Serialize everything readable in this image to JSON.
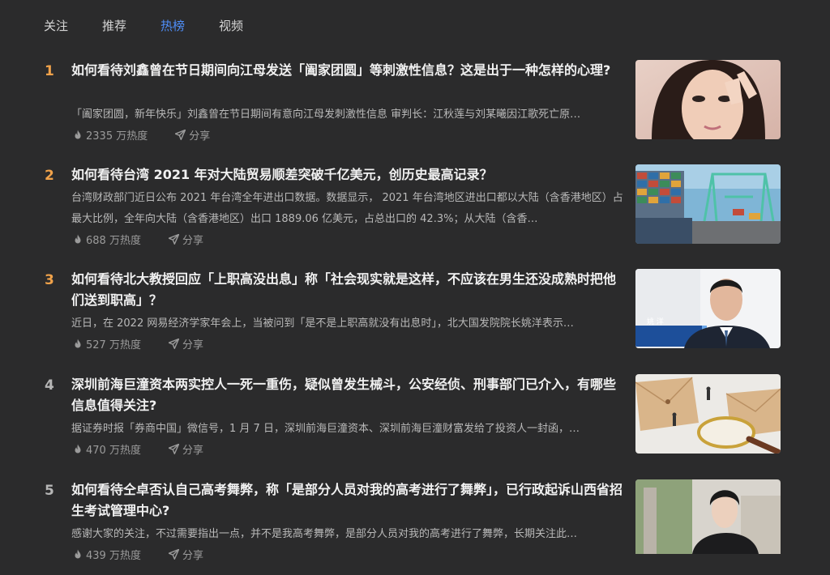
{
  "tabs": [
    {
      "label": "关注",
      "active": false
    },
    {
      "label": "推荐",
      "active": false
    },
    {
      "label": "热榜",
      "active": true
    },
    {
      "label": "视频",
      "active": false
    }
  ],
  "accent_color": "#4f8ef7",
  "rank_highlight_color": "#f0a24a",
  "items": [
    {
      "rank": "1",
      "title": "如何看待刘鑫曾在节日期间向江母发送「阖家团圆」等刺激性信息？这是出于一种怎样的心理?",
      "excerpt": "「阖家团圆，新年快乐」刘鑫曾在节日期间有意向江母发刺激性信息 审判长：江秋莲与刘某曦因江歌死亡原…",
      "heat": "2335 万热度",
      "share": "分享",
      "thumb_icon": "woman-selfie-photo"
    },
    {
      "rank": "2",
      "title": "如何看待台湾 2021 年对大陆贸易顺差突破千亿美元，创历史最高记录？",
      "excerpt": "台湾财政部门近日公布 2021 年台湾全年进出口数据。数据显示， 2021 年台湾地区进出口都以大陆（含香港地区）占最大比例，全年向大陆（含香港地区）出口 1889.06 亿美元，占总出口的 42.3%；从大陆（含香…",
      "heat": "688 万热度",
      "share": "分享",
      "thumb_icon": "container-port-photo"
    },
    {
      "rank": "3",
      "title": "如何看待北大教授回应「上职高没出息」称「社会现实就是这样，不应该在男生还没成熟时把他们送到职高」？",
      "excerpt": "近日，在 2022 网易经济学家年会上，当被问到「是不是上职高就没有出息时」，北大国发院院长姚洋表示…",
      "heat": "527 万热度",
      "share": "分享",
      "thumb_icon": "professor-interview-photo",
      "thumb_caption": "姚 洋"
    },
    {
      "rank": "4",
      "title": "深圳前海巨潼资本两实控人一死一重伤，疑似曾发生械斗，公安经侦、刑事部门已介入，有哪些信息值得关注?",
      "excerpt": "据证券时报「券商中国」微信号，1 月 7 日，深圳前海巨潼资本、深圳前海巨潼财富发给了投资人一封函，…",
      "heat": "470 万热度",
      "share": "分享",
      "thumb_icon": "magnifier-envelope-photo"
    },
    {
      "rank": "5",
      "title": "如何看待仝卓否认自己高考舞弊，称「是部分人员对我的高考进行了舞弊」，已行政起诉山西省招生考试管理中心?",
      "excerpt": "感谢大家的关注，不过需要指出一点，并不是我高考舞弊，是部分人员对我的高考进行了舞弊，长期关注此…",
      "heat": "439 万热度",
      "share": "分享",
      "thumb_icon": "young-man-portrait-photo"
    }
  ]
}
